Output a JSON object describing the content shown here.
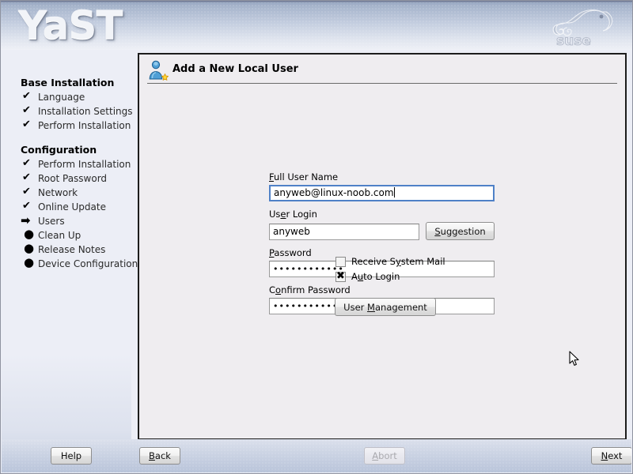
{
  "app": {
    "logo_text": "YaST",
    "brand_mark": "suse-chameleon-logo"
  },
  "sidebar": {
    "groups": [
      {
        "title": "Base Installation",
        "items": [
          {
            "label": "Language",
            "marker": "check"
          },
          {
            "label": "Installation Settings",
            "marker": "check"
          },
          {
            "label": "Perform Installation",
            "marker": "check"
          }
        ]
      },
      {
        "title": "Configuration",
        "items": [
          {
            "label": "Perform Installation",
            "marker": "check"
          },
          {
            "label": "Root Password",
            "marker": "check"
          },
          {
            "label": "Network",
            "marker": "check"
          },
          {
            "label": "Online Update",
            "marker": "check"
          },
          {
            "label": "Users",
            "marker": "arrow"
          },
          {
            "label": "Clean Up",
            "marker": "bullet"
          },
          {
            "label": "Release Notes",
            "marker": "bullet"
          },
          {
            "label": "Device Configuration",
            "marker": "bullet"
          }
        ]
      }
    ],
    "markers": {
      "check": "✔",
      "arrow": "➡",
      "bullet": "●"
    }
  },
  "dialog": {
    "icon": "add-user-icon",
    "title": "Add a New Local User",
    "fields": {
      "full_name": {
        "label_pre": "",
        "label_accel": "F",
        "label_post": "ull User Name",
        "value": "anyweb@linux-noob.com",
        "focused": true
      },
      "user_login": {
        "label_pre": "Us",
        "label_accel": "e",
        "label_post": "r Login",
        "value": "anyweb",
        "focused": false
      },
      "password": {
        "label_pre": "",
        "label_accel": "P",
        "label_post": "assword",
        "value": "••••••••••••",
        "focused": false
      },
      "confirm_password": {
        "label_pre": "C",
        "label_accel": "o",
        "label_post": "nfirm Password",
        "value": "••••••••••••",
        "focused": false
      }
    },
    "suggestion_button": {
      "pre": "",
      "accel": "S",
      "post": "uggestion"
    },
    "checkboxes": [
      {
        "pre": "Receive S",
        "accel": "y",
        "post": "stem Mail",
        "checked": false,
        "mark": "✖"
      },
      {
        "pre": "A",
        "accel": "u",
        "post": "to Login",
        "checked": true,
        "mark": "✖"
      }
    ],
    "user_management_button": {
      "pre": "User ",
      "accel": "M",
      "post": "anagement"
    }
  },
  "footer": {
    "buttons": [
      {
        "name": "help",
        "pre": "Help",
        "accel": "",
        "post": "",
        "disabled": false
      },
      {
        "name": "back",
        "pre": "",
        "accel": "B",
        "post": "ack",
        "disabled": false
      },
      {
        "name": "abort",
        "pre": "",
        "accel": "A",
        "post": "bort",
        "disabled": true
      },
      {
        "name": "next",
        "pre": "",
        "accel": "N",
        "post": "ext",
        "disabled": false
      }
    ]
  },
  "colors": {
    "header_gradient_top": "#93a4bf",
    "header_gradient_bottom": "#eef0f6",
    "sidebar_bg": "#eceef6",
    "panel_bg": "#efedf0",
    "panel_border": "#1c1c1c",
    "focus_border": "#4f81c7",
    "footer_bg": "#ccd4e4",
    "disabled_text": "#a9a9ae"
  }
}
